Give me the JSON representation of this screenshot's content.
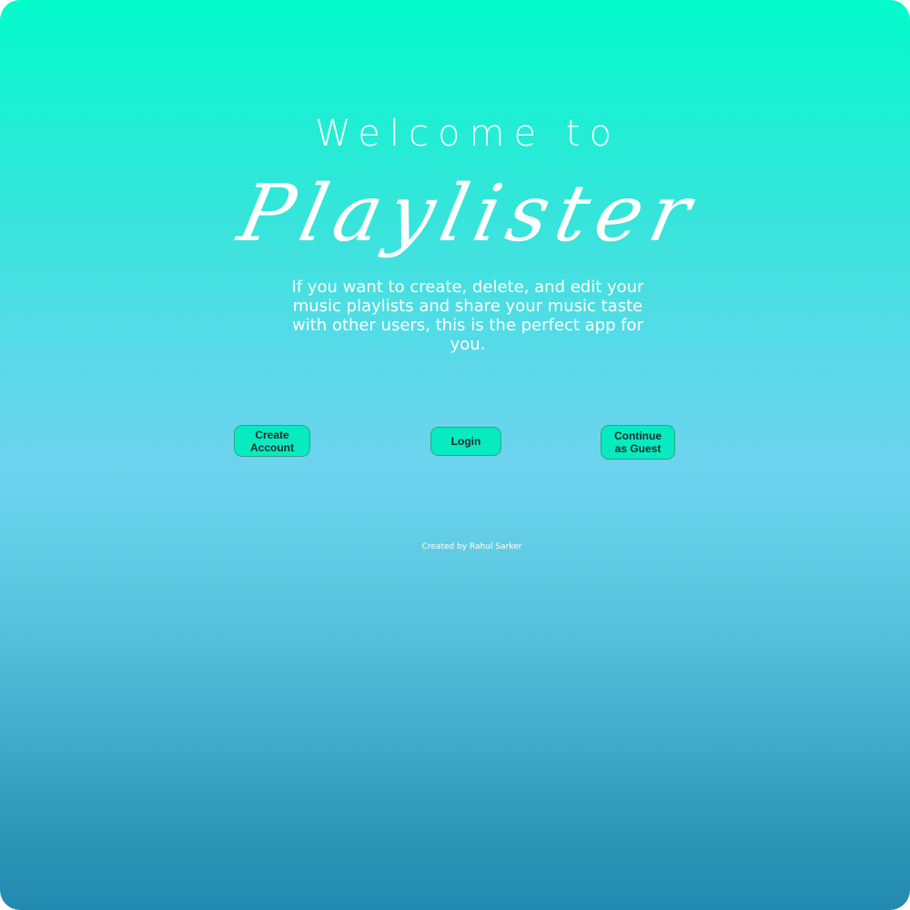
{
  "hero": {
    "welcome": "Welcome to",
    "brand": "Playlister",
    "description": "If you want to create, delete, and edit your music playlists and share your music taste with other users, this is the perfect app for you."
  },
  "actions": {
    "create_account": "Create Account",
    "login": "Login",
    "guest": "Continue as Guest"
  },
  "footer": {
    "credit": "Created by Rahul Sarker"
  },
  "colors": {
    "gradient_top": "#03fbcc",
    "gradient_middle": "#6dd4ee",
    "gradient_bottom": "#228ab0",
    "button_fill": "#08eac0"
  }
}
